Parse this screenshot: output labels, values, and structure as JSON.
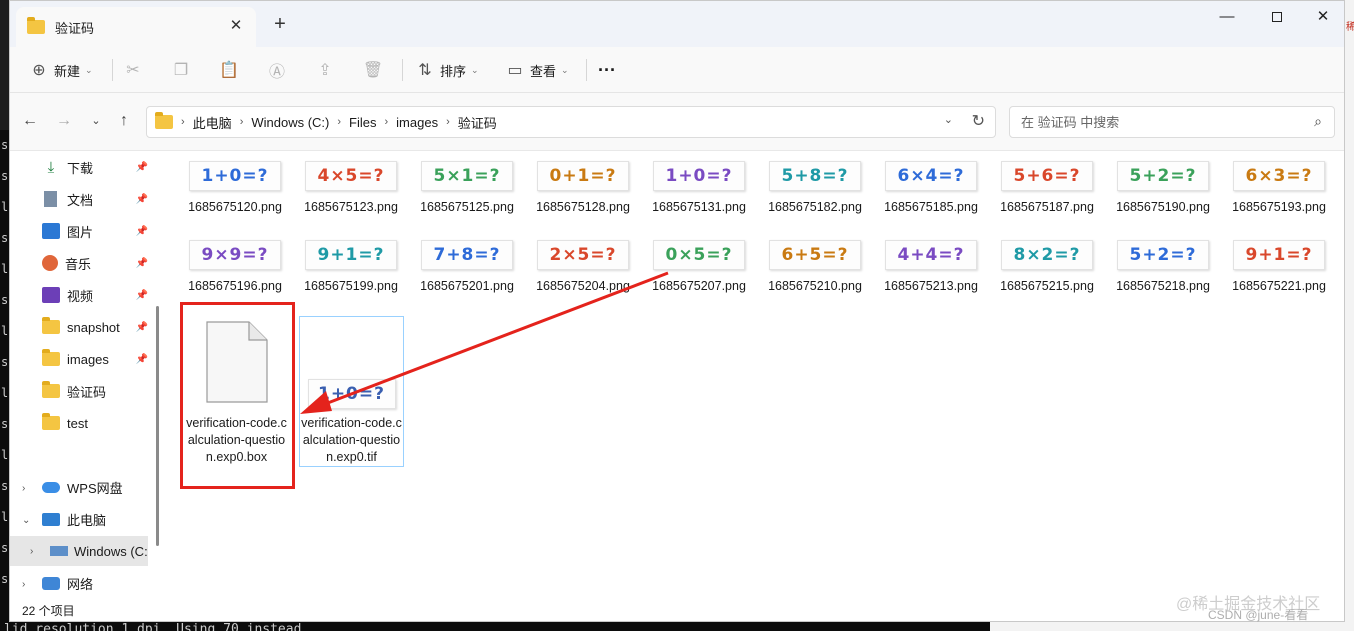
{
  "window": {
    "tab_title": "验证码",
    "tab_close": "✕",
    "tab_add": "+",
    "minimize": "—",
    "close": "✕"
  },
  "toolbar": {
    "new_label": "新建",
    "sort_label": "排序",
    "view_label": "查看",
    "more": "···"
  },
  "address": {
    "crumbs": [
      "此电脑",
      "Windows (C:)",
      "Files",
      "images",
      "验证码"
    ],
    "search_placeholder": "在 验证码 中搜索"
  },
  "sidebar": {
    "quick": [
      {
        "label": "下载",
        "icon": "download-icon",
        "pinned": true
      },
      {
        "label": "文档",
        "icon": "document-icon",
        "pinned": true
      },
      {
        "label": "图片",
        "icon": "pictures-icon",
        "pinned": true
      },
      {
        "label": "音乐",
        "icon": "music-icon",
        "pinned": true
      },
      {
        "label": "视频",
        "icon": "video-icon",
        "pinned": true
      },
      {
        "label": "snapshot",
        "icon": "folder-icon",
        "pinned": true
      },
      {
        "label": "images",
        "icon": "folder-icon",
        "pinned": true
      },
      {
        "label": "验证码",
        "icon": "folder-icon",
        "pinned": false
      },
      {
        "label": "test",
        "icon": "folder-icon",
        "pinned": false
      }
    ],
    "wps": "WPS网盘",
    "this_pc": "此电脑",
    "windows_c": "Windows (C:",
    "network": "网络"
  },
  "files": [
    {
      "name": "1685675120.png",
      "captcha": "1+0=?"
    },
    {
      "name": "1685675123.png",
      "captcha": "4×5=?"
    },
    {
      "name": "1685675125.png",
      "captcha": "5×1=?"
    },
    {
      "name": "1685675128.png",
      "captcha": "0+1=?"
    },
    {
      "name": "1685675131.png",
      "captcha": "1+0=?"
    },
    {
      "name": "1685675182.png",
      "captcha": "5+8=?"
    },
    {
      "name": "1685675185.png",
      "captcha": "6×4=?"
    },
    {
      "name": "1685675187.png",
      "captcha": "5+6=?"
    },
    {
      "name": "1685675190.png",
      "captcha": "5+2=?"
    },
    {
      "name": "1685675193.png",
      "captcha": "6×3=?"
    },
    {
      "name": "1685675196.png",
      "captcha": "9×9=?"
    },
    {
      "name": "1685675199.png",
      "captcha": "9+1=?"
    },
    {
      "name": "1685675201.png",
      "captcha": "7+8=?"
    },
    {
      "name": "1685675204.png",
      "captcha": "2×5=?"
    },
    {
      "name": "1685675207.png",
      "captcha": "0×5=?"
    },
    {
      "name": "1685675210.png",
      "captcha": "6+5=?"
    },
    {
      "name": "1685675213.png",
      "captcha": "4+4=?"
    },
    {
      "name": "1685675215.png",
      "captcha": "8×2=?"
    },
    {
      "name": "1685675218.png",
      "captcha": "5+2=?"
    },
    {
      "name": "1685675221.png",
      "captcha": "9+1=?"
    }
  ],
  "box_file": "verification-code.calculation-question.exp0.box",
  "tif_file": {
    "name": "verification-code.calculation-question.exp0.tif",
    "captcha": "1+0=?"
  },
  "status": {
    "count": "22 个项目"
  },
  "background": {
    "terminal_bottom": "lid resolution 1 dpi. Using 70 instead.",
    "watermark1": "@稀土掘金技术社区",
    "watermark2": "CSDN @june-看看"
  },
  "colors": {
    "arrow": "#e4231c",
    "highlight": "#e4231c",
    "selection": "#99d1ff"
  }
}
